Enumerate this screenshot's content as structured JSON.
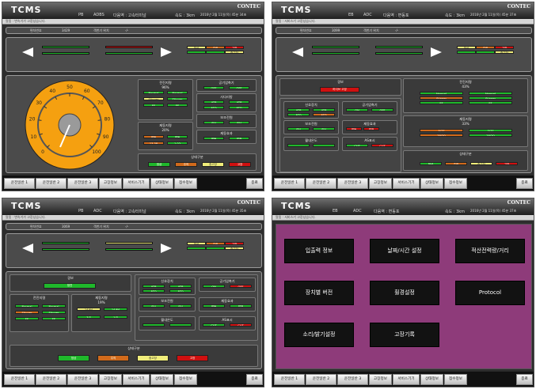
{
  "header": {
    "logo": "TCMS",
    "brand": "CONTEC",
    "speed": "속도 : 3km"
  },
  "s1": {
    "code1": "PB",
    "code2": "ADBS",
    "station": "다음역 : 고속터미널",
    "dt": "2016년 2월 11일(목) 45분 34초",
    "msg": "알림 : 변속기가 고장났습니다.",
    "car_label": "편차번호",
    "car": "3429",
    "pos_label": "객번기 위치",
    "pos": "-/-",
    "gauge_ticks": [
      "0",
      "10",
      "20",
      "30",
      "40",
      "50",
      "60",
      "70",
      "80",
      "90",
      "100"
    ],
    "sa": {
      "t": "전진지령",
      "p": "96%",
      "n1": "Normal",
      "n2": "Normal",
      "s1": "Stinger",
      "s2": "Stinger",
      "c1": "FF",
      "c2": "FF"
    },
    "sb": {
      "t": "제동지령",
      "p": "20%",
      "a": "제동",
      "b": "제동",
      "c": "13.38",
      "d": "1.02"
    },
    "sc": {
      "t": "공기압축기",
      "a": "OFF",
      "b": "OFF"
    },
    "sd": {
      "t": "사다리방",
      "a": "ATP",
      "b": "ATP",
      "c": "ATO",
      "d": "ATO"
    },
    "se": {
      "t": "보조전원",
      "a": "SIV",
      "b": "SIV"
    },
    "sf": {
      "t": "제동효과",
      "a": "제동",
      "b": "발전"
    },
    "sg": {
      "t": "상태구분",
      "a": "정상",
      "b": "주의",
      "c": "중고장",
      "d": "고장"
    },
    "legend": [
      "정상",
      "주의",
      "중고장",
      "고장"
    ]
  },
  "s2": {
    "code1": "EB",
    "code2": "ADC",
    "station": "다음역 : 변동포",
    "dt": "2016년 2월 11일(목) 45분 37초",
    "msg": "알림 : 서비스기 고장났습니다.",
    "car_label": "편차번호",
    "car": "3099",
    "pos_label": "객번기 위치",
    "pos": "-/-",
    "warn_t": "경보",
    "warn_btn": "하이브 고장",
    "ta": {
      "t": "전진지령",
      "p": "43%"
    },
    "tb": {
      "t": "제동지령",
      "p": "33%"
    },
    "tc": {
      "t": "신호장치",
      "a": "ATP",
      "b": "ATP",
      "c": "ATO",
      "d": "ATO"
    },
    "td": {
      "t": "공기압축기",
      "a": "ON",
      "b": "OFF"
    },
    "te": {
      "t": "보조전원",
      "a": "SIV",
      "b": "SIV"
    },
    "tf": {
      "t": "제동효과",
      "a": "제동",
      "b": "발전"
    },
    "tg": {
      "t": "월내온도",
      "a": "-",
      "b": "-"
    },
    "th": {
      "t": "AS표시",
      "a": "CUT",
      "b": "CUT"
    },
    "ti": {
      "t": "상태구분",
      "a": "정상",
      "b": "주의",
      "c": "중고장",
      "d": "고장"
    }
  },
  "s3": {
    "code1": "PB",
    "code2": "ADC",
    "station": "다음역 : 고속터미널",
    "dt": "2016년 2월 11일(목) 45분 35초",
    "msg": "알림 : 변속기가 고장났습니다.",
    "car_label": "편차번호",
    "car": "3069",
    "pos_label": "객번기 위치",
    "pos": "-/-",
    "warn_t": "경보",
    "warn_btn": "정전",
    "ua": {
      "t": "전진지령",
      "p": "86%",
      "a": "Normal",
      "b": "Normal",
      "c": "Stinger",
      "d": "Stinger",
      "e": "FF",
      "f": "FF"
    },
    "ub": {
      "t": "제동지령",
      "p": "19%",
      "a": "14/64",
      "b": "14/64",
      "c": "7/7",
      "d": "1/7"
    },
    "uc": {
      "t": "신호장치",
      "a": "ATP",
      "b": "ATP",
      "c": "ATO",
      "d": "ATO"
    },
    "ud": {
      "t": "공기압축기",
      "a": "ON",
      "b": "OFF"
    },
    "ue": {
      "t": "보조전원",
      "a": "SIV",
      "b": "SIV"
    },
    "uf": {
      "t": "제동효과",
      "a": "제동",
      "b": "발전"
    },
    "ug": {
      "t": "월내온도",
      "a": "-",
      "b": "-"
    },
    "uh": {
      "t": "AS표시",
      "a": "CUT",
      "b": "CUT"
    },
    "ui": {
      "t": "상태구분",
      "a": "정상",
      "b": "주의",
      "c": "중고장",
      "d": "고장"
    }
  },
  "s4": {
    "code1": "EB",
    "code2": "ADC",
    "station": "다음역 : 변동포",
    "dt": "2016년 2월 11일(목) 45분 37초",
    "msg": "알림 : 서비스기 고장났습니다.",
    "menu": [
      "입출력 정보",
      "날짜/시간 설정",
      "적산전력량/거리",
      "장치별 버전",
      "휠경설정",
      "Protocol",
      "소리/밝기설정",
      "고장기록"
    ]
  },
  "footer": [
    "운전일반 1",
    "운전일반 2",
    "운전일반 3",
    "고장정보",
    "서비스기기",
    "상태정보",
    "점수정보"
  ],
  "footer_end": "종료",
  "colors": {
    "green": "#1fb82b",
    "orange": "#d16a1b",
    "red": "#d01010",
    "yellow": "#f0ed7a",
    "gauge": "#f5a010",
    "menu_bg": "#8e3b7a"
  }
}
